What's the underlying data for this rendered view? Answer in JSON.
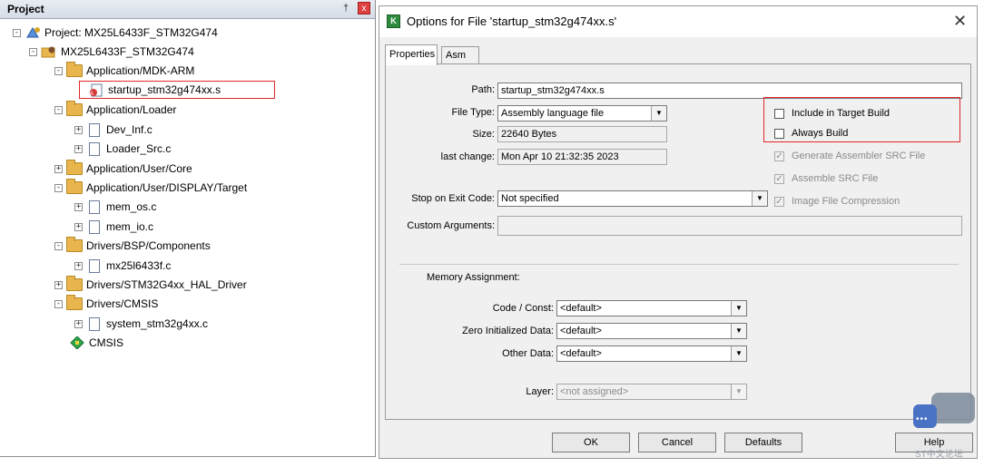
{
  "project_panel": {
    "title": "Project",
    "pin_glyph": "†",
    "close_glyph": "x",
    "tree": [
      {
        "label": "Project: MX25L6433F_STM32G474",
        "depth": 0,
        "expander": "-",
        "icon": "project-icon"
      },
      {
        "label": "MX25L6433F_STM32G474",
        "depth": 1,
        "expander": "-",
        "icon": "target-icon"
      },
      {
        "label": "Application/MDK-ARM",
        "depth": 2,
        "expander": "-",
        "icon": "folder-icon"
      },
      {
        "label": "startup_stm32g474xx.s",
        "depth": 3,
        "expander": "",
        "icon": "asm-file-icon",
        "selected": true
      },
      {
        "label": "Application/Loader",
        "depth": 2,
        "expander": "-",
        "icon": "folder-icon"
      },
      {
        "label": "Dev_Inf.c",
        "depth": 3,
        "expander": "+",
        "icon": "file-icon"
      },
      {
        "label": "Loader_Src.c",
        "depth": 3,
        "expander": "+",
        "icon": "file-icon"
      },
      {
        "label": "Application/User/Core",
        "depth": 2,
        "expander": "+",
        "icon": "folder-icon"
      },
      {
        "label": "Application/User/DISPLAY/Target",
        "depth": 2,
        "expander": "-",
        "icon": "folder-icon"
      },
      {
        "label": "mem_os.c",
        "depth": 3,
        "expander": "+",
        "icon": "file-icon"
      },
      {
        "label": "mem_io.c",
        "depth": 3,
        "expander": "+",
        "icon": "file-icon"
      },
      {
        "label": "Drivers/BSP/Components",
        "depth": 2,
        "expander": "-",
        "icon": "folder-icon"
      },
      {
        "label": "mx25l6433f.c",
        "depth": 3,
        "expander": "+",
        "icon": "file-icon"
      },
      {
        "label": "Drivers/STM32G4xx_HAL_Driver",
        "depth": 2,
        "expander": "+",
        "icon": "folder-icon"
      },
      {
        "label": "Drivers/CMSIS",
        "depth": 2,
        "expander": "-",
        "icon": "folder-icon"
      },
      {
        "label": "system_stm32g4xx.c",
        "depth": 3,
        "expander": "+",
        "icon": "file-icon"
      },
      {
        "label": "CMSIS",
        "depth": 2,
        "expander": "",
        "icon": "cmsis-diamond-icon"
      }
    ]
  },
  "dialog": {
    "title": "Options for File 'startup_stm32g474xx.s'",
    "close_glyph": "✕",
    "tabs": [
      {
        "label": "Properties",
        "active": true
      },
      {
        "label": "Asm",
        "active": false
      }
    ],
    "path_label": "Path:",
    "path_value": "startup_stm32g474xx.s",
    "file_type_label": "File Type:",
    "file_type_value": "Assembly language file",
    "size_label": "Size:",
    "size_value": "22640 Bytes",
    "last_change_label": "last change:",
    "last_change_value": "Mon Apr 10 21:32:35 2023",
    "stop_on_exit_label": "Stop on Exit Code:",
    "stop_on_exit_value": "Not specified",
    "custom_args_label": "Custom Arguments:",
    "custom_args_value": "",
    "checkboxes": [
      {
        "label": "Include in Target Build",
        "checked": false,
        "enabled": true
      },
      {
        "label": "Always Build",
        "checked": false,
        "enabled": true
      },
      {
        "label": "Generate Assembler SRC File",
        "checked": true,
        "enabled": false
      },
      {
        "label": "Assemble SRC File",
        "checked": true,
        "enabled": false
      },
      {
        "label": "Image File Compression",
        "checked": true,
        "enabled": false
      }
    ],
    "memory": {
      "title": "Memory Assignment:",
      "code_label": "Code / Const:",
      "code_value": "<default>",
      "zero_label": "Zero Initialized Data:",
      "zero_value": "<default>",
      "other_label": "Other Data:",
      "other_value": "<default>",
      "layer_label": "Layer:",
      "layer_value": "<not assigned>"
    },
    "buttons": {
      "ok": "OK",
      "cancel": "Cancel",
      "defaults": "Defaults",
      "help": "Help"
    },
    "dropdown_glyph": "▼"
  },
  "watermark": {
    "text": "ST中文论坛",
    "dots": "•••"
  },
  "colors": {
    "highlight_box": "#e02828",
    "folder": "#e8b64c",
    "dialog_bg": "#f0f0f0"
  }
}
